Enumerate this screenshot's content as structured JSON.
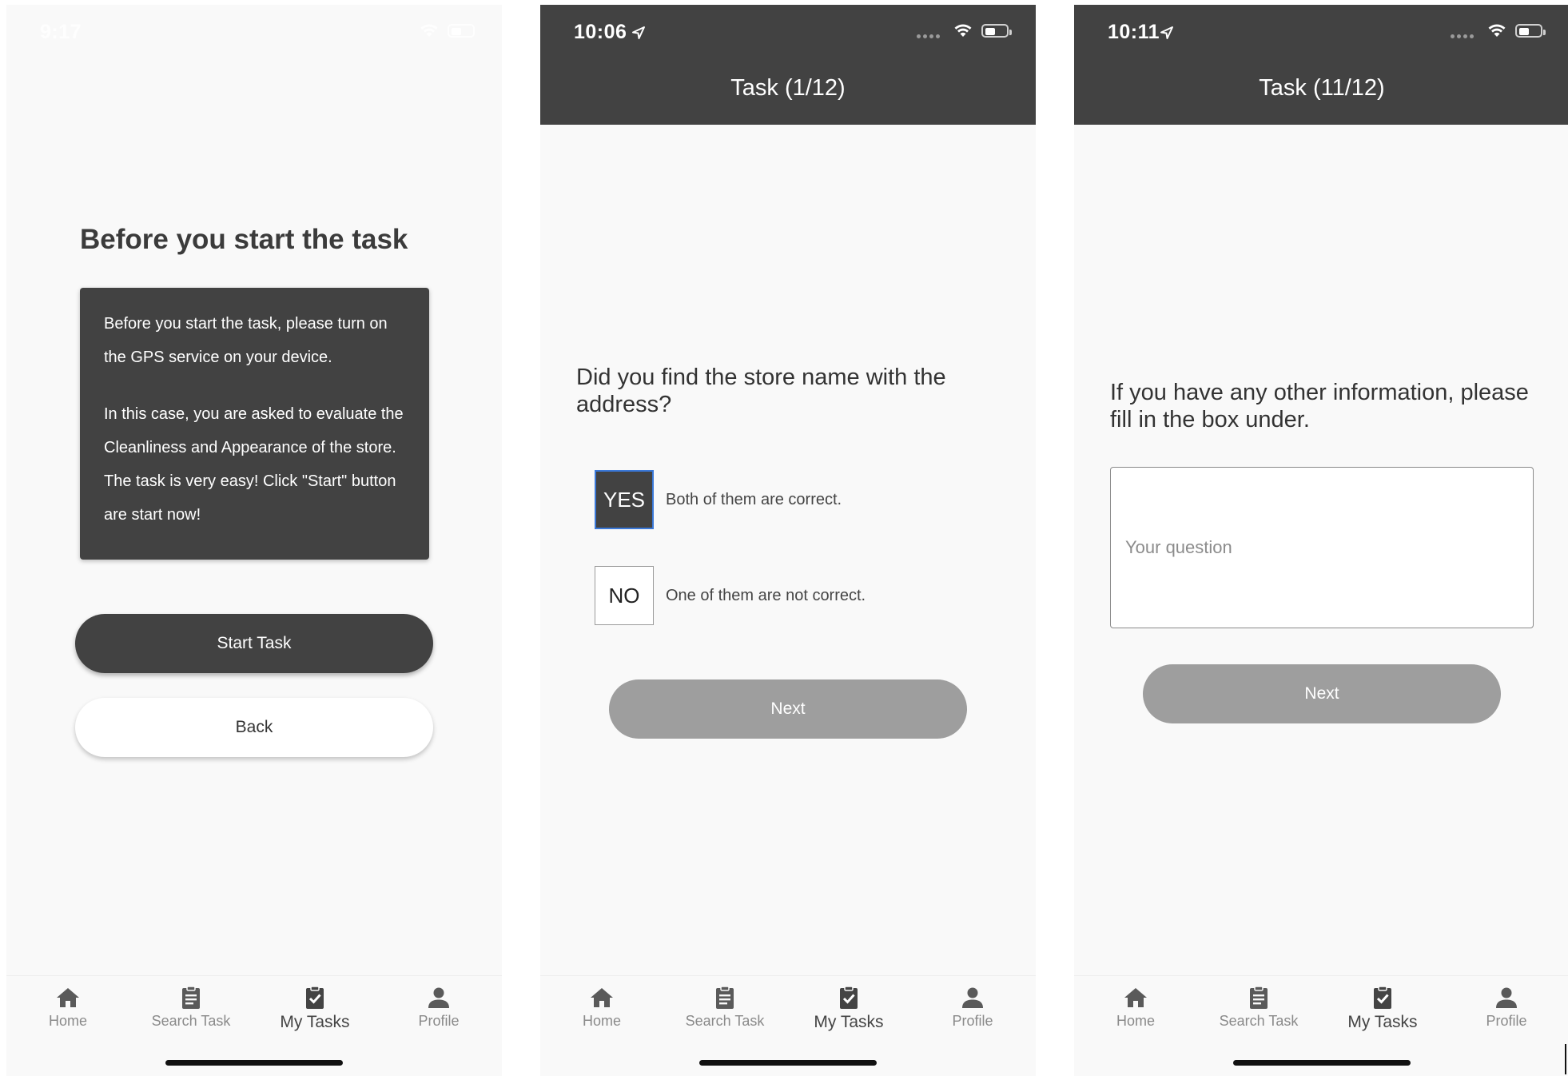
{
  "screens": [
    {
      "status_time": "9:17",
      "heading": "Before you start the task",
      "info_paragraphs": [
        "Before you start the task, please turn on the GPS service on your device.",
        "In this case, you are asked to evaluate the Cleanliness and Appearance of the store. The task is very easy! Click \"Start\" button are start now!"
      ],
      "start_button": "Start Task",
      "back_button": "Back"
    },
    {
      "status_time": "10:06",
      "header_title": "Task (1/12)",
      "question": "Did you find the store name with the address?",
      "options": [
        {
          "label": "YES",
          "text": "Both of them are correct.",
          "selected": true
        },
        {
          "label": "NO",
          "text": "One of them are not correct.",
          "selected": false
        }
      ],
      "next_button": "Next"
    },
    {
      "status_time": "10:11",
      "header_title": "Task (11/12)",
      "question": "If you have any other information, please fill in the box under.",
      "input_placeholder": "Your question",
      "input_value": "",
      "next_button": "Next"
    }
  ],
  "tabs": [
    {
      "label": "Home",
      "icon": "home-icon",
      "active": false
    },
    {
      "label": "Search Task",
      "icon": "clipboard-list-icon",
      "active": false
    },
    {
      "label": "My Tasks",
      "icon": "clipboard-check-icon",
      "active": true
    },
    {
      "label": "Profile",
      "icon": "person-icon",
      "active": false
    }
  ],
  "colors": {
    "dark": "#424242",
    "background": "#f9f9f9",
    "disabled_button": "#9e9e9e",
    "selected_border": "#3a78d8"
  }
}
